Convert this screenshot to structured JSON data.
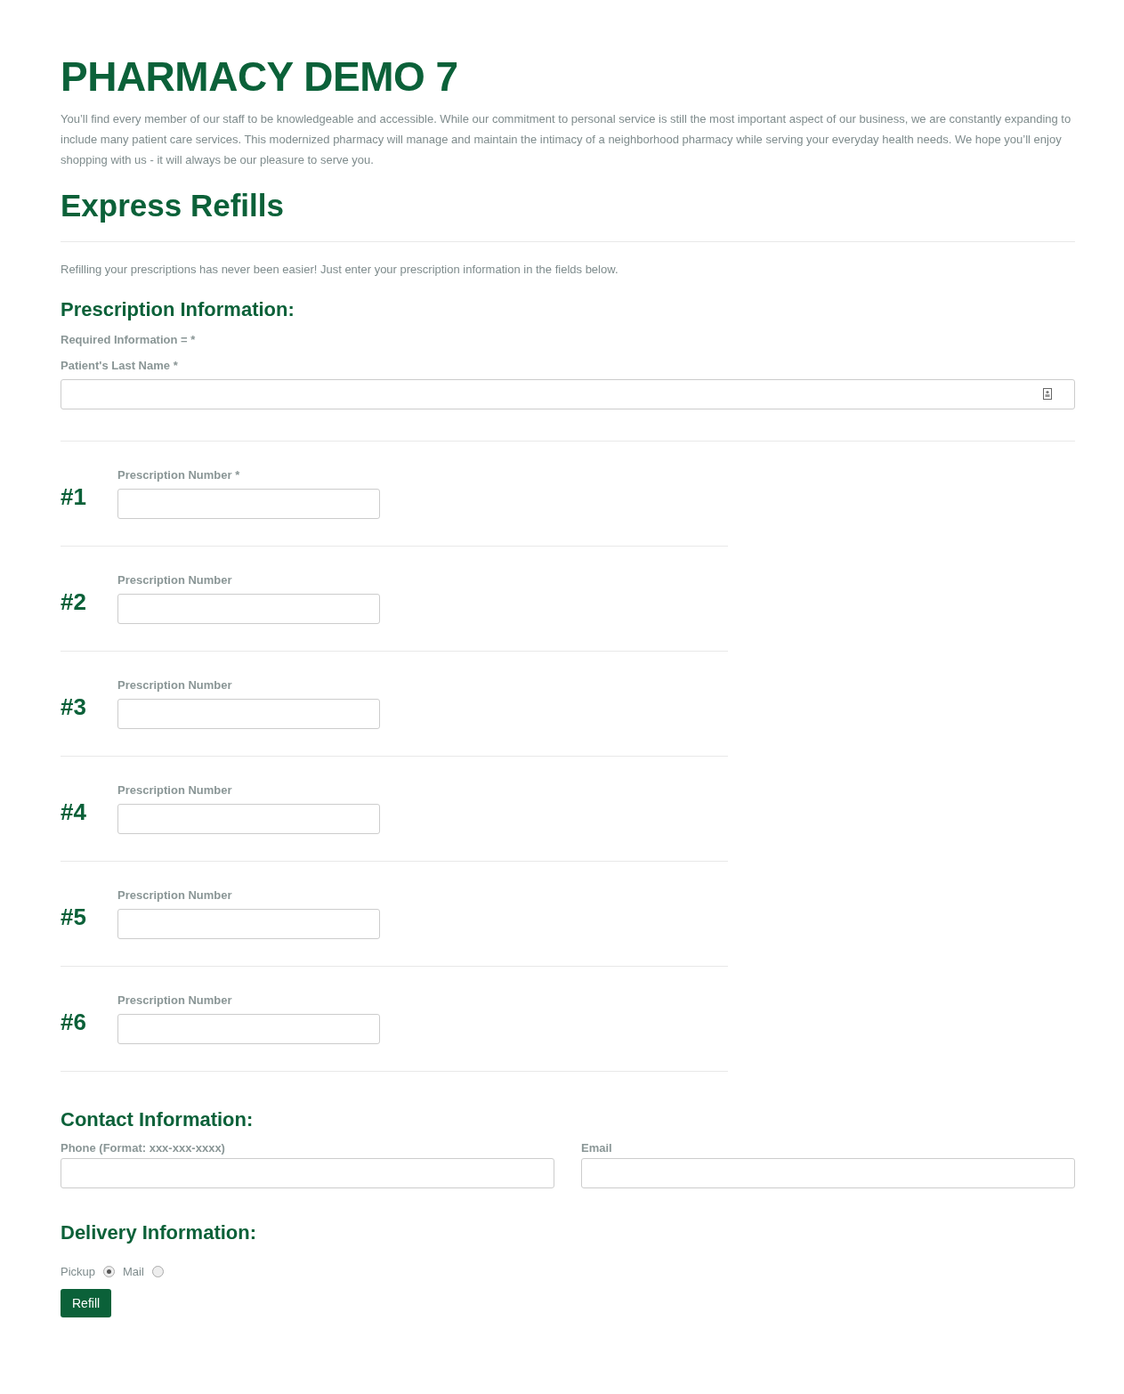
{
  "title": "PHARMACY DEMO 7",
  "intro": "You’ll find every member of our staff to be knowledgeable and accessible. While our commitment to personal service is still the most important aspect of our business, we are constantly expanding to include many patient care services. This modernized pharmacy will manage and maintain the intimacy of a neighborhood pharmacy while serving your everyday health needs. We hope you’ll enjoy shopping with us - it will always be our pleasure to serve you.",
  "section_title": "Express Refills",
  "section_intro": "Refilling your prescriptions has never been easier! Just enter your prescription information in the fields below.",
  "prescription": {
    "heading": "Prescription Information:",
    "required_note": "Required Information = *",
    "last_name_label": "Patient's Last Name *",
    "rows": [
      {
        "number": "#1",
        "label": "Prescription Number *"
      },
      {
        "number": "#2",
        "label": "Prescription Number"
      },
      {
        "number": "#3",
        "label": "Prescription Number"
      },
      {
        "number": "#4",
        "label": "Prescription Number"
      },
      {
        "number": "#5",
        "label": "Prescription Number"
      },
      {
        "number": "#6",
        "label": "Prescription Number"
      }
    ]
  },
  "contact": {
    "heading": "Contact Information:",
    "phone_label": "Phone (Format: xxx-xxx-xxxx)",
    "email_label": "Email"
  },
  "delivery": {
    "heading": "Delivery Information:",
    "options": [
      {
        "label": "Pickup",
        "selected": true
      },
      {
        "label": "Mail",
        "selected": false
      }
    ]
  },
  "submit": "Refill"
}
